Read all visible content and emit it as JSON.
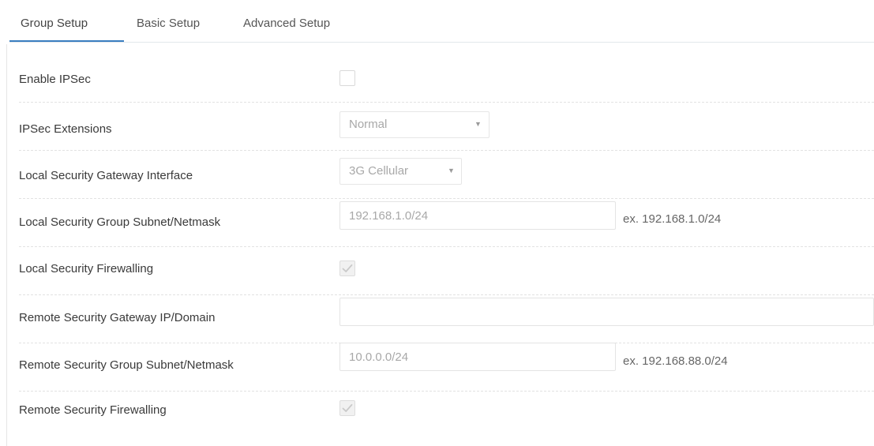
{
  "tabs": [
    {
      "label": "Group Setup",
      "active": true
    },
    {
      "label": "Basic Setup",
      "active": false
    },
    {
      "label": "Advanced Setup",
      "active": false
    }
  ],
  "form": {
    "enable_ipsec": {
      "label": "Enable IPSec",
      "checked": false
    },
    "ipsec_extensions": {
      "label": "IPSec Extensions",
      "value": "Normal"
    },
    "local_gateway_interface": {
      "label": "Local Security Gateway Interface",
      "value": "3G Cellular"
    },
    "local_subnet": {
      "label": "Local Security Group Subnet/Netmask",
      "value": "192.168.1.0/24",
      "hint": "ex. 192.168.1.0/24"
    },
    "local_firewalling": {
      "label": "Local Security Firewalling",
      "checked": true
    },
    "remote_gateway": {
      "label": "Remote Security Gateway IP/Domain",
      "value": ""
    },
    "remote_subnet": {
      "label": "Remote Security Group Subnet/Netmask",
      "value": "10.0.0.0/24",
      "hint": "ex. 192.168.88.0/24"
    },
    "remote_firewalling": {
      "label": "Remote Security Firewalling",
      "checked": true
    }
  },
  "icons": {
    "select_arrow": "chevron-down-icon",
    "checkmark": "check-icon"
  },
  "colors": {
    "active_tab_underline": "#3a7ec0",
    "label_text": "#3a3a3a",
    "disabled_text": "#a8a8a8"
  }
}
